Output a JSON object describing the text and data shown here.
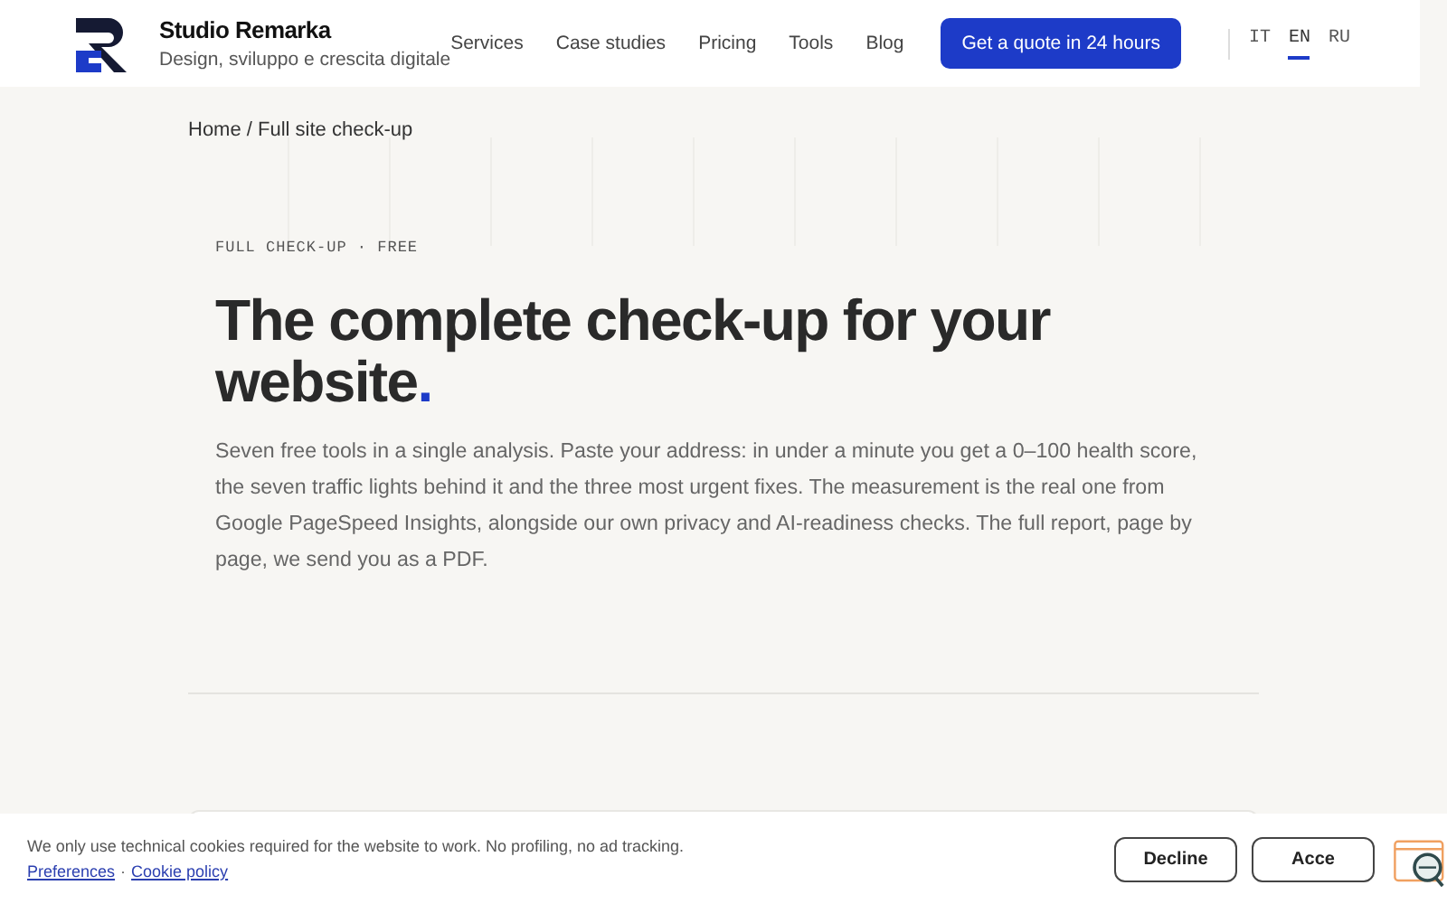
{
  "brand": {
    "name": "Studio Remarka",
    "tagline": "Design, sviluppo e crescita digitale"
  },
  "nav": [
    {
      "label": "Services"
    },
    {
      "label": "Case studies"
    },
    {
      "label": "Pricing"
    },
    {
      "label": "Tools"
    },
    {
      "label": "Blog"
    }
  ],
  "cta": "Get a quote in 24 hours",
  "languages": [
    {
      "label": "IT",
      "selected": false
    },
    {
      "label": "EN",
      "selected": true
    },
    {
      "label": "RU",
      "selected": false
    }
  ],
  "breadcrumb": "Home / Full site check-up",
  "eyebrow": "FULL CHECK-UP · FREE",
  "title": "The complete check-up for your website",
  "title_dot": ".",
  "intro": "Seven free tools in a single analysis. Paste your address: in under a minute you get a 0–100 health score, the seven traffic lights behind it and the three most urgent fixes. The measurement is the real one from Google PageSpeed Insights, alongside our own privacy and AI-readiness checks. The full report, page by page, we send you as a PDF.",
  "cookie_bar": {
    "message": "We only use technical cookies required for the website to work. No profiling, no ad tracking.",
    "links": [
      "Preferences",
      "Cookie policy"
    ],
    "separator": "·",
    "buttons": [
      "Decline",
      "Acce"
    ]
  }
}
